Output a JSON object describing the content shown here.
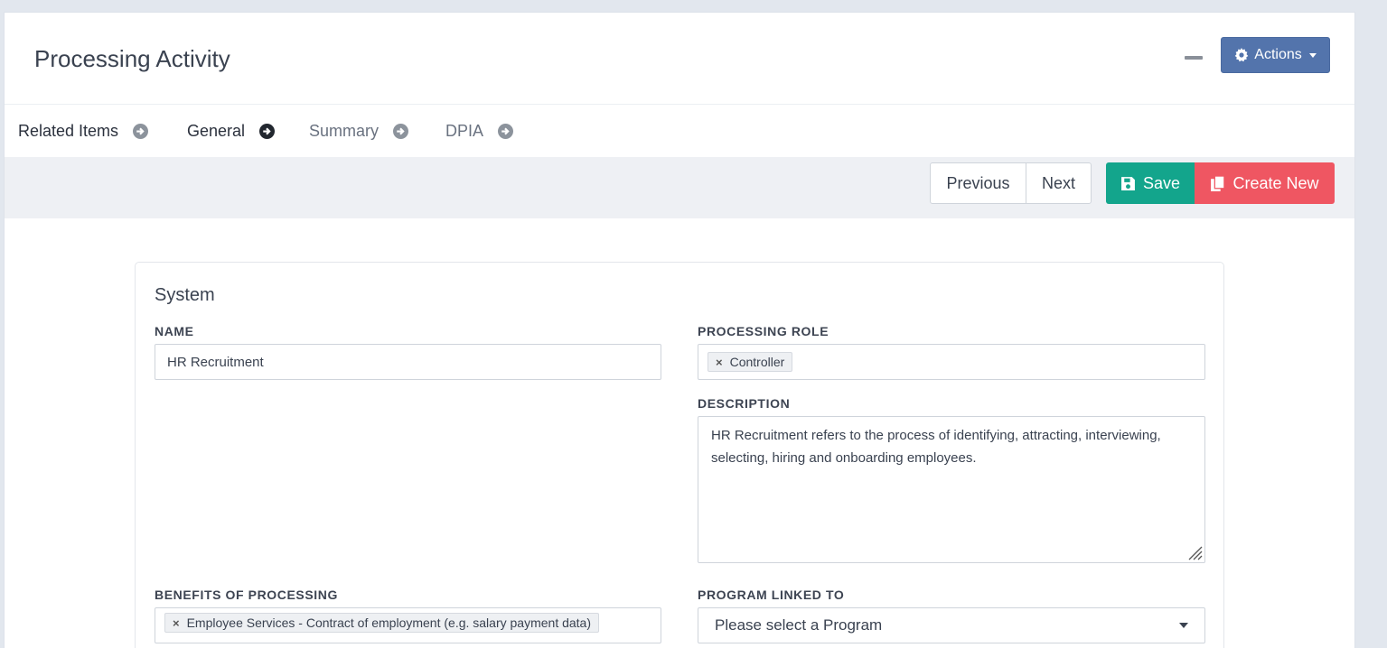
{
  "header": {
    "title": "Processing Activity",
    "actions_label": "Actions"
  },
  "tabs": [
    {
      "label": "Related Items",
      "active": false
    },
    {
      "label": "General",
      "active": true
    },
    {
      "label": "Summary",
      "active": false
    },
    {
      "label": "DPIA",
      "active": false
    }
  ],
  "toolbar": {
    "previous_label": "Previous",
    "next_label": "Next",
    "save_label": "Save",
    "create_new_label": "Create New"
  },
  "form": {
    "section_title": "System",
    "name_label": "NAME",
    "name_value": "HR Recruitment",
    "processing_role_label": "PROCESSING ROLE",
    "processing_role_tags": [
      "Controller"
    ],
    "description_label": "DESCRIPTION",
    "description_value": "HR Recruitment refers to the process of identifying, attracting, interviewing, selecting, hiring and onboarding employees.",
    "benefits_label": "BENEFITS OF PROCESSING",
    "benefits_tags": [
      "Employee Services - Contract of employment (e.g. salary payment data)"
    ],
    "program_label": "PROGRAM LINKED TO",
    "program_value": "Please select a Program"
  },
  "colors": {
    "actions_bg": "#5374ac",
    "save_bg": "#13a58c",
    "create_bg": "#ef5662",
    "active_tab_underline": "#177a8c",
    "inactive_tab_underline": "#c9ccd1"
  }
}
